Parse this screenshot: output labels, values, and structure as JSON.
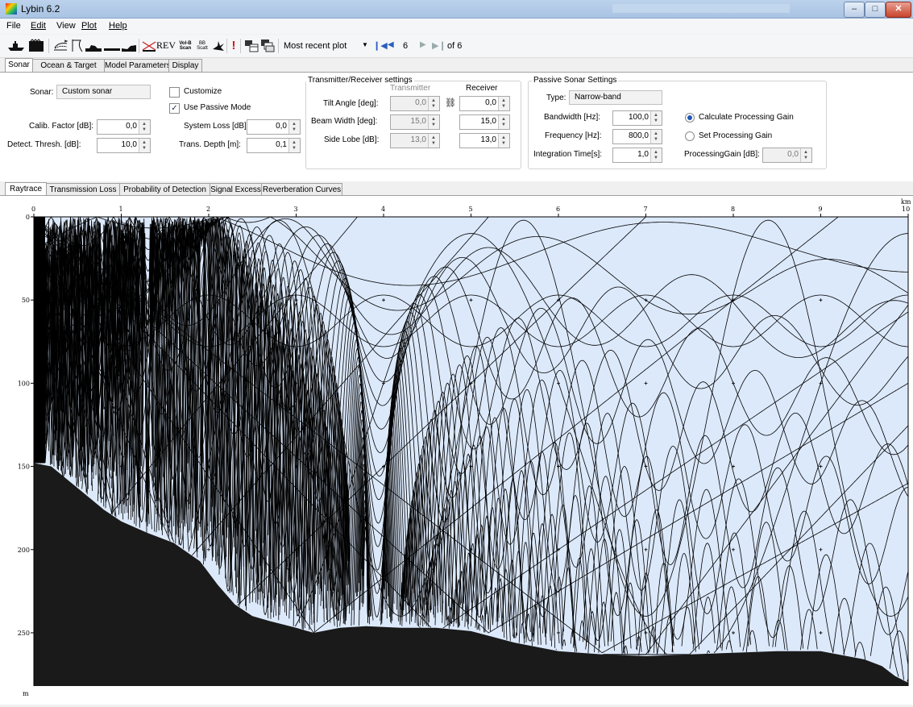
{
  "window": {
    "title": "Lybin 6.2"
  },
  "menu": [
    "File",
    "Edit",
    "View",
    "Plot",
    "Help"
  ],
  "toolbar": {
    "rev_label": "REV",
    "vol_label": "Vol-B Scan",
    "bb_label": "BB Scatt",
    "alert_label": "!",
    "plot_selector": "Most recent plot",
    "plot_number": "6",
    "plot_total": "of 6"
  },
  "top_tabs": [
    "Sonar",
    "Ocean & Target",
    "Model Parameters",
    "Display"
  ],
  "sonar": {
    "sonar_label": "Sonar:",
    "sonar_value": "Custom sonar",
    "calib_label": "Calib. Factor [dB]:",
    "calib_value": "0,0",
    "detect_label": "Detect. Thresh. [dB]:",
    "detect_value": "10,0",
    "customize_label": "Customize",
    "customize_checked": false,
    "passive_label": "Use Passive Mode",
    "passive_checked": true,
    "sysloss_label": "System Loss [dB]:",
    "sysloss_value": "0,0",
    "transdepth_label": "Trans. Depth [m]:",
    "transdepth_value": "0,1"
  },
  "txrx": {
    "title": "Transmitter/Receiver settings",
    "col_transmitter": "Transmitter",
    "col_receiver": "Receiver",
    "tilt_label": "Tilt Angle [deg]:",
    "tilt_tx": "0,0",
    "tilt_rx": "0,0",
    "beam_label": "Beam Width [deg]:",
    "beam_tx": "15,0",
    "beam_rx": "15,0",
    "lobe_label": "Side Lobe [dB]:",
    "lobe_tx": "13,0",
    "lobe_rx": "13,0"
  },
  "passive": {
    "title": "Passive Sonar Settings",
    "type_label": "Type:",
    "type_value": "Narrow-band",
    "bandwidth_label": "Bandwidth [Hz]:",
    "bandwidth_value": "100,0",
    "frequency_label": "Frequency [Hz]:",
    "frequency_value": "800,0",
    "integration_label": "Integration Time[s]:",
    "integration_value": "1,0",
    "calc_gain_label": "Calculate Processing Gain",
    "calc_gain_selected": true,
    "set_gain_label": "Set Processing Gain",
    "gain_label": "ProcessingGain [dB]:",
    "gain_value": "0,0"
  },
  "result_tabs": [
    "Raytrace",
    "Transmission Loss",
    "Probability of Detection",
    "Signal Excess",
    "Reverberation Curves"
  ],
  "chart_data": {
    "type": "raytrace",
    "x": {
      "min": 0,
      "max": 10,
      "ticks": [
        "0",
        "1",
        "2",
        "3",
        "4",
        "5",
        "6",
        "7",
        "8",
        "9",
        "10"
      ],
      "unit": "km"
    },
    "y": {
      "min": 0,
      "max": 282,
      "ticks": [
        "0",
        "50",
        "100",
        "150",
        "200",
        "250"
      ],
      "unit": "m"
    },
    "colors": {
      "water": "#dce9fb",
      "bottom": "#1a1a1a",
      "rays": "#000000"
    },
    "bottom_profile": [
      [
        0,
        148
      ],
      [
        0.2,
        150
      ],
      [
        0.5,
        163
      ],
      [
        0.8,
        176
      ],
      [
        1.0,
        183
      ],
      [
        1.3,
        190
      ],
      [
        1.6,
        196
      ],
      [
        1.9,
        207
      ],
      [
        2.1,
        221
      ],
      [
        2.3,
        233
      ],
      [
        2.5,
        240
      ],
      [
        2.7,
        243
      ],
      [
        3.0,
        247
      ],
      [
        3.2,
        250
      ],
      [
        3.5,
        247
      ],
      [
        3.8,
        246
      ],
      [
        4.2,
        247
      ],
      [
        4.6,
        247
      ],
      [
        5.0,
        249
      ],
      [
        5.5,
        256
      ],
      [
        6.0,
        261
      ],
      [
        6.5,
        263
      ],
      [
        7.0,
        264
      ],
      [
        7.5,
        263
      ],
      [
        8.0,
        262
      ],
      [
        8.5,
        261
      ],
      [
        9.0,
        261
      ],
      [
        9.5,
        266
      ],
      [
        9.7,
        270
      ],
      [
        9.85,
        276
      ],
      [
        10.0,
        280
      ]
    ],
    "ray_family": [
      {
        "min_depth": 47,
        "max_depth": 78,
        "half_period": 1.0,
        "count": 2
      },
      {
        "min_depth": 2,
        "max_depth": 240,
        "half_period": 1.4,
        "count": 1
      },
      {
        "min_depth": 10,
        "max_depth": 270,
        "half_period": 2.5,
        "count": 1
      }
    ]
  }
}
